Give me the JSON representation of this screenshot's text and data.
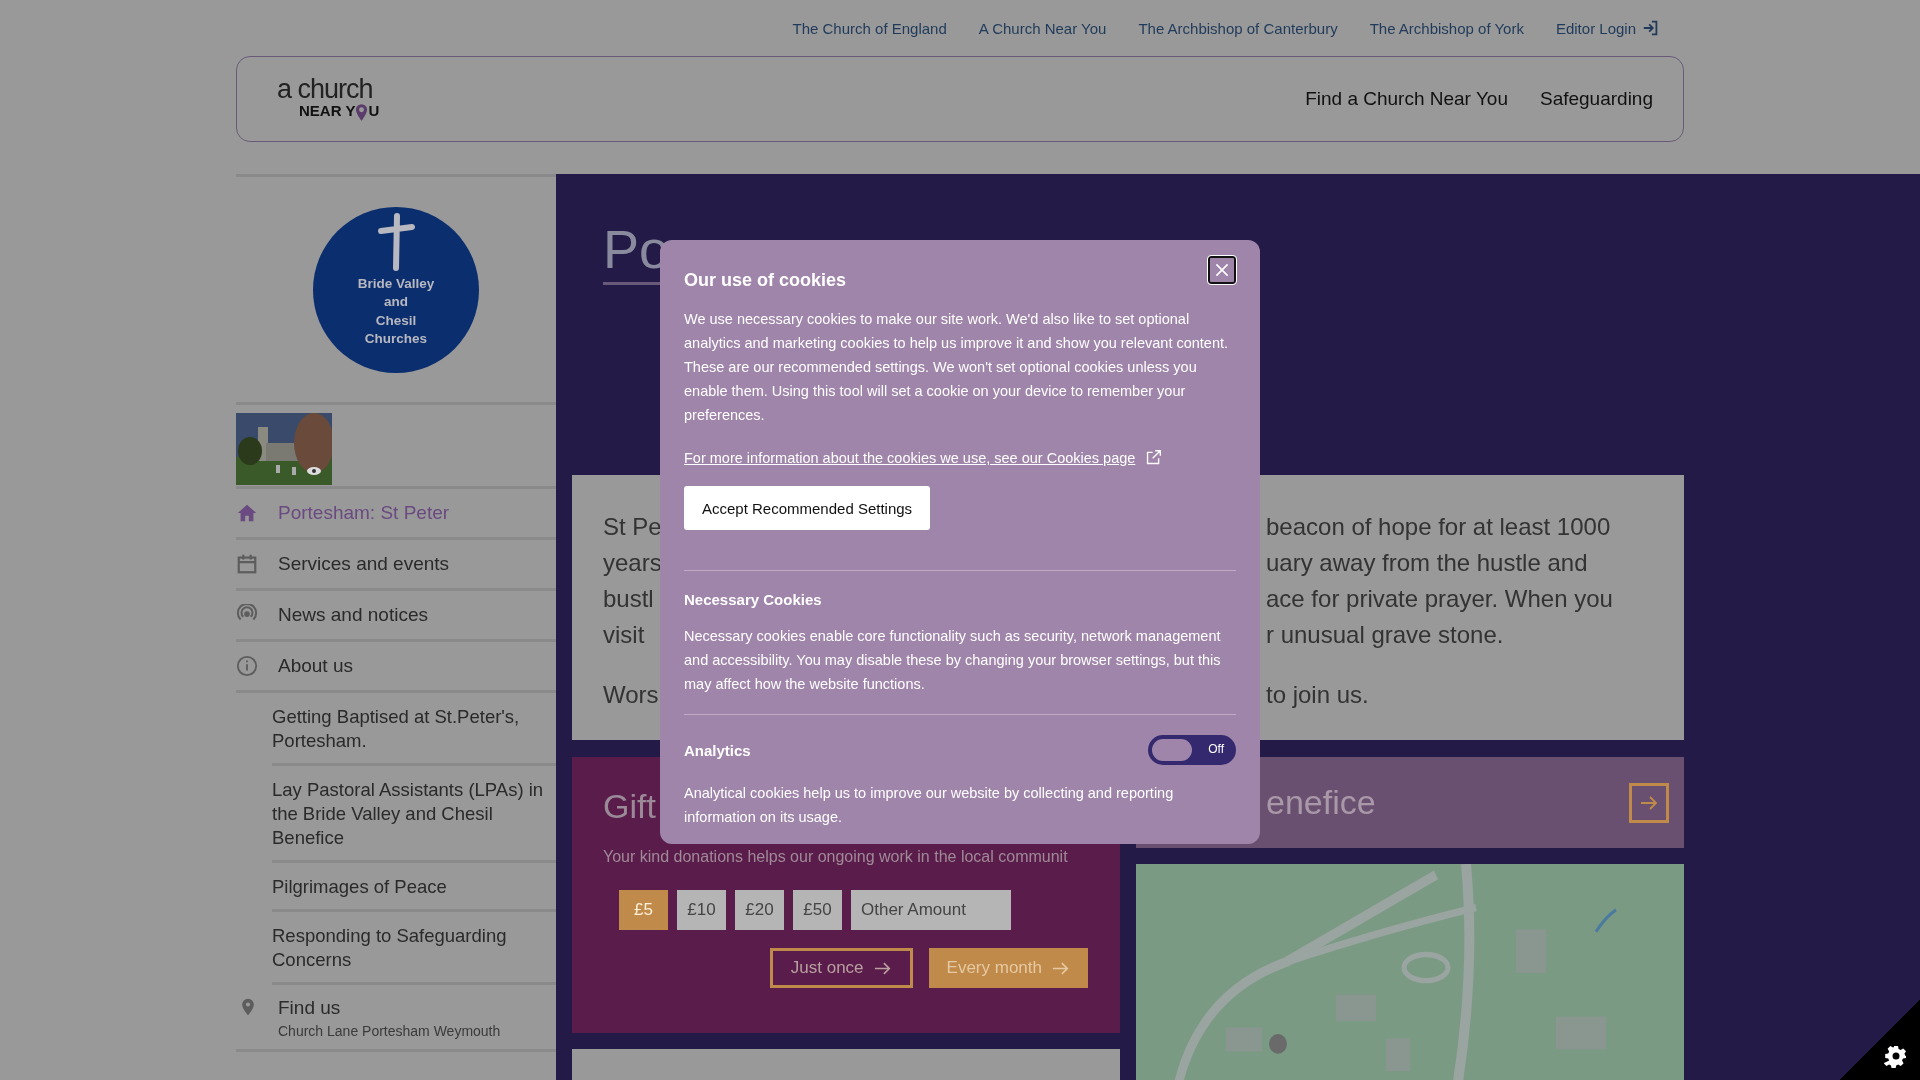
{
  "top_links": [
    {
      "label": "The Church of England"
    },
    {
      "label": "A Church Near You"
    },
    {
      "label": "The Archbishop of Canterbury"
    },
    {
      "label": "The Archbishop of York"
    },
    {
      "label": "Editor Login"
    }
  ],
  "header": {
    "logo": {
      "line1": "a church",
      "line2_start": "NEAR Y",
      "line2_end": "U"
    },
    "nav": [
      "Find a Church Near You",
      "Safeguarding"
    ]
  },
  "sidebar": {
    "church_logo": [
      "Bride Valley",
      "and",
      "Chesil",
      "Churches"
    ],
    "items": [
      {
        "label": "Portesham: St Peter",
        "selected": true
      },
      {
        "label": "Services and events",
        "selected": false
      },
      {
        "label": "News and notices",
        "selected": false
      },
      {
        "label": "About us",
        "selected": false,
        "children": [
          {
            "label": "Getting Baptised at St.Peter's, Portesham."
          },
          {
            "label": "Lay Pastoral Assistants (LPAs) in the Bride Valley and Chesil Benefice"
          },
          {
            "label": "Pilgrimages of Peace"
          },
          {
            "label": "Responding to Safeguarding Concerns"
          }
        ]
      }
    ],
    "find_us": {
      "label": "Find us",
      "address": "Church Lane Portesham Weymouth"
    }
  },
  "main": {
    "title": "Po",
    "intro_left": [
      "St Pe",
      "years",
      "bustl",
      "visit"
    ],
    "intro_right": [
      "beacon of hope for at least 1000",
      "uary away from the hustle and",
      "ace for private prayer. When you",
      "r unusual grave stone."
    ],
    "worship_left": "Wors",
    "worship_right": "to join us.",
    "gift": {
      "title": "Gift",
      "text": "Your kind donations helps our ongoing work in the local communit",
      "amounts": [
        {
          "label": "£5",
          "selected": true
        },
        {
          "label": "£10",
          "selected": false
        },
        {
          "label": "£20",
          "selected": false
        },
        {
          "label": "£50",
          "selected": false
        }
      ],
      "other_placeholder": "Other Amount",
      "frequency": [
        {
          "label": "Just once",
          "kind": "outline"
        },
        {
          "label": "Every month",
          "kind": "filled"
        }
      ]
    },
    "benefice": {
      "title": "enefice"
    }
  },
  "cookie_dialog": {
    "title": "Our use of cookies",
    "intro": "We use necessary cookies to make our site work. We'd also like to set optional analytics and marketing cookies to help us improve it and show you relevant content. These are our recommended settings. We won't set optional cookies unless you enable them. Using this tool will set a cookie on your device to remember your preferences.",
    "link": "For more information about the cookies we use, see our Cookies page",
    "accept_button": "Accept Recommended Settings",
    "sections": [
      {
        "title": "Necessary Cookies",
        "text": "Necessary cookies enable core functionality such as security, network management and accessibility. You may disable these by changing your browser settings, but this may affect how the website functions."
      },
      {
        "title": "Analytics",
        "toggle": {
          "on": false,
          "label": "Off"
        },
        "text": "Analytical cookies help us to improve our website by collecting and reporting information on its usage."
      }
    ]
  }
}
